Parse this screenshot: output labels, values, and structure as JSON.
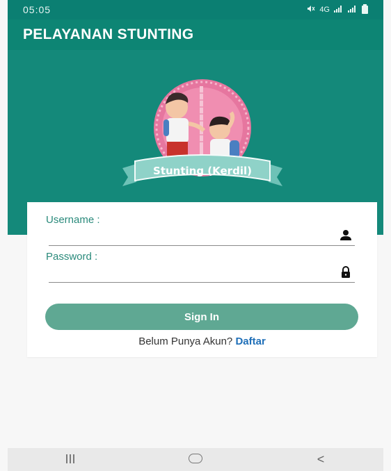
{
  "status_bar": {
    "time": "05:05",
    "network_text": "4G"
  },
  "app_bar": {
    "title": "PELAYANAN STUNTING"
  },
  "logo": {
    "banner_text": "Stunting (Kerdil)"
  },
  "login_form": {
    "username_label": "Username :",
    "username_value": "",
    "password_label": "Password :",
    "password_value": "",
    "sign_in_label": "Sign In",
    "register_prompt": "Belum Punya Akun?",
    "register_link": "Daftar"
  },
  "nav_bar": {
    "recents_symbol": "III",
    "back_symbol": "<"
  },
  "icons": {
    "user": "user-icon",
    "lock": "lock-icon"
  },
  "colors": {
    "primary": "#0d8574",
    "hero_background": "#14897a",
    "button": "#5fa893",
    "link": "#1f6fb8",
    "label": "#2a8a7b"
  }
}
